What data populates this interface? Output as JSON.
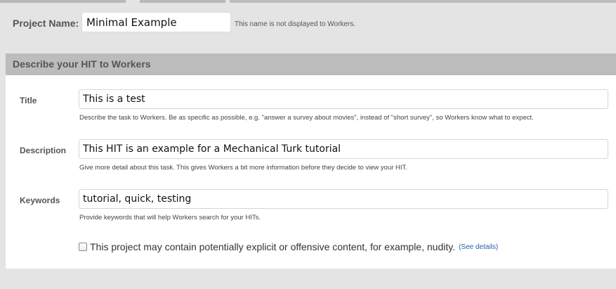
{
  "project": {
    "label": "Project Name:",
    "value": "Minimal Example",
    "hint": "This name is not displayed to Workers."
  },
  "section": {
    "header": "Describe your HIT to Workers"
  },
  "fields": {
    "title": {
      "label": "Title",
      "value": "This is a test",
      "hint": "Describe the task to Workers. Be as specific as possible, e.g. \"answer a survey about movies\", instead of \"short survey\", so Workers know what to expect."
    },
    "description": {
      "label": "Description",
      "value": "This HIT is an example for a Mechanical Turk tutorial",
      "hint": "Give more detail about this task. This gives Workers a bit more information before they decide to view your HIT."
    },
    "keywords": {
      "label": "Keywords",
      "value": "tutorial, quick, testing",
      "hint": "Provide keywords that will help Workers search for your HITs."
    }
  },
  "adult_content": {
    "label": "This project may contain potentially explicit or offensive content, for example, nudity.",
    "link": "(See details)",
    "checked": false
  }
}
